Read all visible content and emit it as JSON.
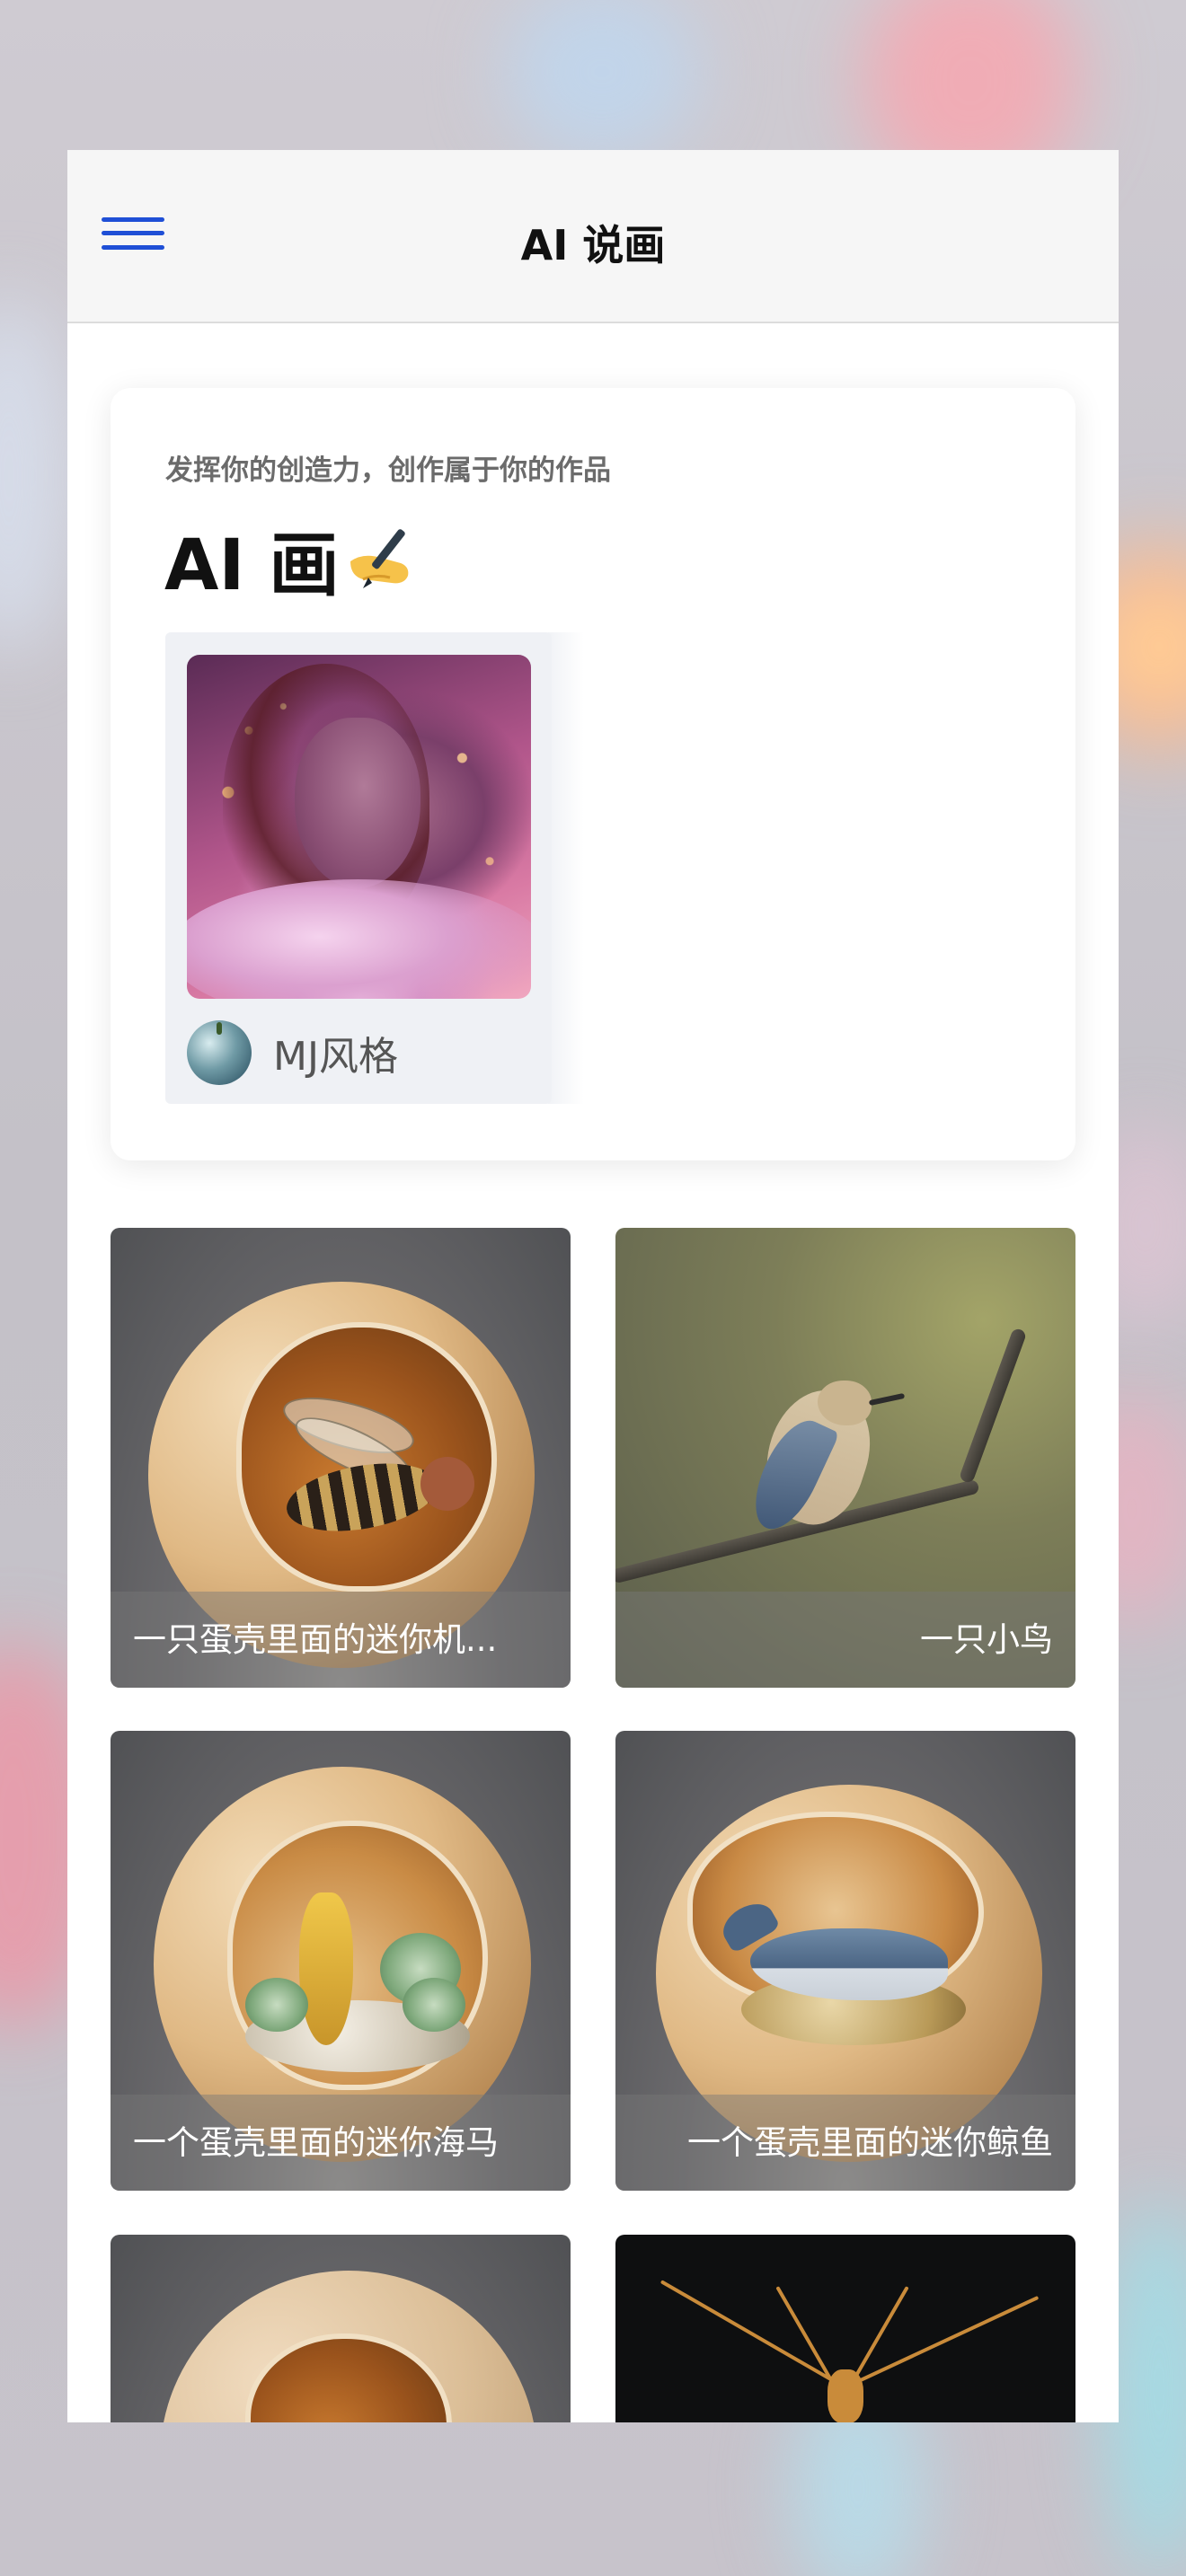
{
  "app": {
    "title": "AI 说画",
    "menu_icon": "hamburger-menu-icon",
    "accent_color": "#1f4fd6"
  },
  "hero": {
    "subtitle": "发挥你的创造力，创作属于你的作品",
    "title": "AI 画",
    "title_icon": "writing-hand-icon",
    "styles": [
      {
        "label": "MJ风格",
        "icon": "apple-logo-icon"
      }
    ]
  },
  "gallery": [
    {
      "caption": "一只蛋壳里面的迷你机..."
    },
    {
      "caption": "一只小鸟"
    },
    {
      "caption": "一个蛋壳里面的迷你海马"
    },
    {
      "caption": "一个蛋壳里面的迷你鲸鱼"
    },
    {
      "caption": ""
    },
    {
      "caption": ""
    }
  ]
}
